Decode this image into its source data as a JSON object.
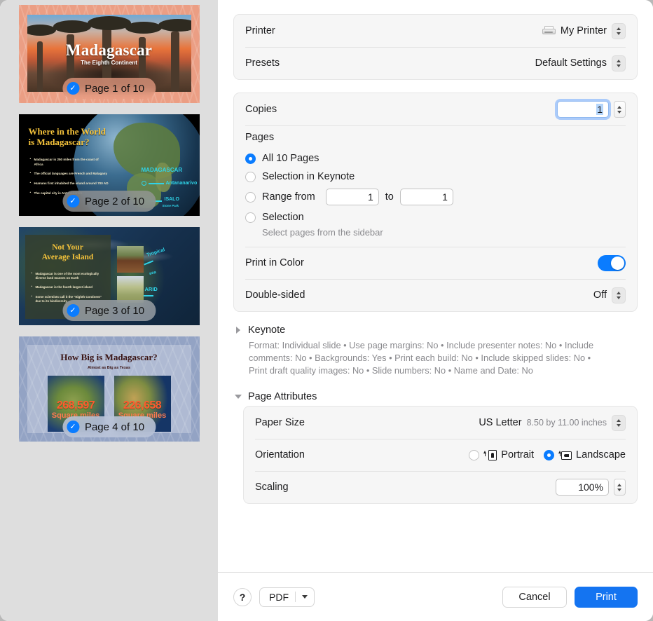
{
  "sidebar": {
    "pages": [
      {
        "badge_label": "Page 1 of 10",
        "selected": true,
        "slide": {
          "title": "Madagascar",
          "subtitle": "The Eighth Continent"
        }
      },
      {
        "badge_label": "Page 2 of 10",
        "selected": true,
        "slide": {
          "title_line1": "Where in the World",
          "title_line2": "is Madagascar?",
          "bullets": [
            "Madagascar is 250 miles from the coast of Africa",
            "The official languages are French and Malagasy",
            "Humans first inhabited the island around 700 AD",
            "The capital city is Antananarivo"
          ],
          "annotations": [
            "MADAGASCAR",
            "Antananarivo",
            "ISALO",
            "Stone Park"
          ]
        }
      },
      {
        "badge_label": "Page 3 of 10",
        "selected": true,
        "slide": {
          "title_line1": "Not Your",
          "title_line2": "Average Island",
          "bullets": [
            "Madagascar is one of the most ecologically diverse land masses on Earth",
            "Madagascar is the fourth largest island",
            "Some scientists call it the \"Eighth Continent\" due to its biodiversity"
          ],
          "annotations": [
            "Tropical",
            "sea",
            "ARID"
          ]
        }
      },
      {
        "badge_label": "Page 4 of 10",
        "selected": true,
        "slide": {
          "title": "How Big is Madagascar?",
          "subtitle": "Almost as Big as Texas",
          "stat_left_value": "268,597",
          "stat_left_unit": "Square miles",
          "stat_right_value": "226,658",
          "stat_right_unit": "Square miles"
        }
      }
    ]
  },
  "print_dialog": {
    "printer": {
      "label": "Printer",
      "value": "My Printer"
    },
    "presets": {
      "label": "Presets",
      "value": "Default Settings"
    },
    "copies": {
      "label": "Copies",
      "value": "1"
    },
    "pages": {
      "label": "Pages",
      "options": [
        {
          "label": "All 10 Pages",
          "selected": true
        },
        {
          "label": "Selection in Keynote",
          "selected": false
        },
        {
          "label": "Range from",
          "selected": false,
          "from": "1",
          "to_label": "to",
          "to": "1"
        },
        {
          "label": "Selection",
          "selected": false
        }
      ],
      "hint": "Select pages from the sidebar"
    },
    "print_in_color": {
      "label": "Print in Color",
      "value": "On"
    },
    "double_sided": {
      "label": "Double-sided",
      "value": "Off"
    },
    "keynote_section": {
      "title": "Keynote",
      "expanded": false,
      "summary": "Format: Individual slide • Use page margins: No • Include presenter notes: No • Include comments: No • Backgrounds: Yes • Print each build: No • Include skipped slides: No • Print draft quality images: No • Slide numbers: No • Name and Date: No"
    },
    "page_attributes_section": {
      "title": "Page Attributes",
      "expanded": true,
      "paper_size": {
        "label": "Paper Size",
        "value": "US Letter",
        "detail": "8.50 by 11.00 inches"
      },
      "orientation": {
        "label": "Orientation",
        "portrait_label": "Portrait",
        "landscape_label": "Landscape",
        "selected": "Landscape"
      },
      "scaling": {
        "label": "Scaling",
        "value": "100%"
      }
    },
    "footer": {
      "help_label": "?",
      "pdf_label": "PDF",
      "cancel_label": "Cancel",
      "print_label": "Print"
    }
  },
  "colors": {
    "accent_blue": "#0a7cff",
    "print_button_blue": "#1474f1",
    "group_background": "#f6f6f6",
    "sidebar_background": "#dedede"
  }
}
